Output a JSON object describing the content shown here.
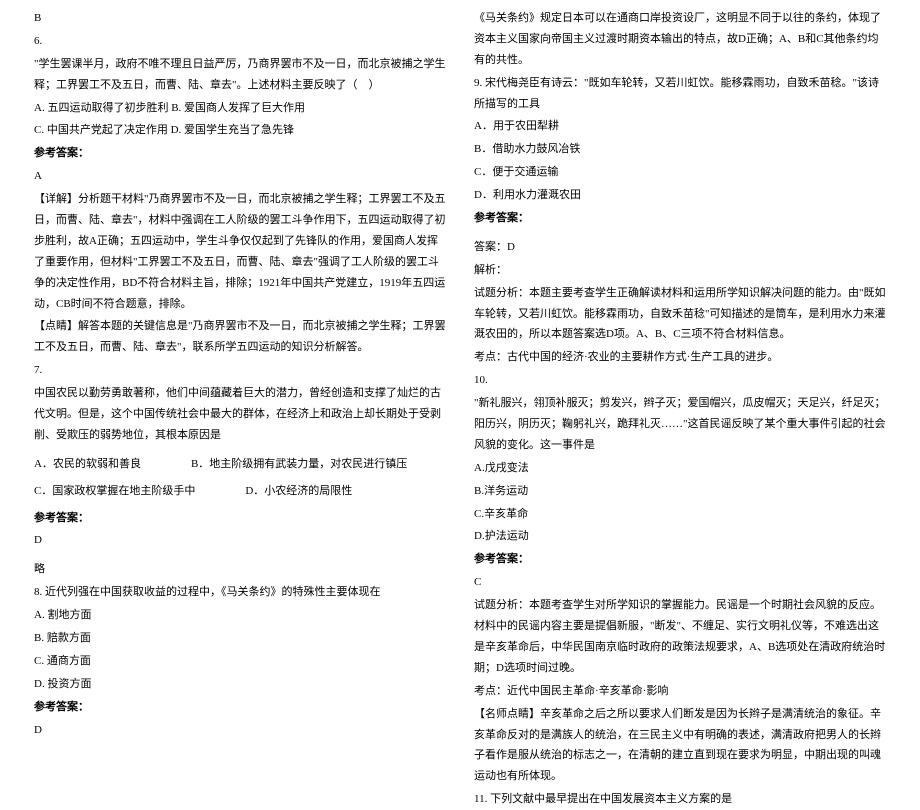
{
  "left": {
    "ansB": "B",
    "q6num": "6.",
    "q6text": "\"学生罢课半月，政府不唯不理且日益严厉，乃商界罢市不及一日，而北京被捕之学生释；工界罢工不及五日，而曹、陆、章去\"。上述材料主要反映了（　）",
    "q6A": "A. 五四运动取得了初步胜利 B. 爱国商人发挥了巨大作用",
    "q6C": "C. 中国共产党起了决定作用 D. 爱国学生充当了急先锋",
    "ref": "参考答案：",
    "q6ans": "A",
    "q6exp1": "【详解】分析题干材料\"乃商界罢市不及一日，而北京被捕之学生释；工界罢工不及五日，而曹、陆、章去\"，材料中强调在工人阶级的罢工斗争作用下，五四运动取得了初步胜利，故A正确；五四运动中，学生斗争仅仅起到了先锋队的作用，爱国商人发挥了重要作用，但材料\"工界罢工不及五日，而曹、陆、章去\"强调了工人阶级的罢工斗争的决定性作用，BD不符合材料主旨，排除；1921年中国共产党建立，1919年五四运动，CB时间不符合题意，排除。",
    "q6exp2": "【点睛】解答本题的关键信息是\"乃商界罢市不及一日，而北京被捕之学生释；工界罢工不及五日，而曹、陆、章去\"，联系所学五四运动的知识分析解答。",
    "q7num": "7.",
    "q7text": "中国农民以勤劳勇敢著称，他们中间蕴藏着巨大的潜力，曾经创造和支撑了灿烂的古代文明。但是，这个中国传统社会中最大的群体，在经济上和政治上却长期处于受剥削、受欺压的弱势地位，其根本原因是",
    "q7A": "A．农民的软弱和善良",
    "q7B": "B．地主阶级拥有武装力量，对农民进行镇压",
    "q7C": "C．国家政权掌握在地主阶级手中",
    "q7D": "D．小农经济的局限性",
    "q7ans": "D",
    "q7note": "略",
    "q8num": "8. 近代列强在中国获取收益的过程中，《马关条约》的特殊性主要体现在",
    "q8A": "A. 割地方面",
    "q8B": "B. 赔款方面",
    "q8C": "C. 通商方面",
    "q8D": "D. 投资方面",
    "q8ans": "D"
  },
  "right": {
    "q8exp": "《马关条约》规定日本可以在通商口岸投资设厂，这明显不同于以往的条约，体现了资本主义国家向帝国主义过渡时期资本输出的特点，故D正确；A、B和C其他条约均有的共性。",
    "q9num": "9. 宋代梅尧臣有诗云：\"既如车轮转，又若川虹饮。能移霖雨功，自致禾苗稔。\"该诗所描写的工具",
    "q9A": "A．用于农田犁耕",
    "q9B": "B．借助水力鼓风冶铁",
    "q9C": "C．便于交通运输",
    "q9D": "D．利用水力灌溉农田",
    "ref": "参考答案：",
    "q9anstitle": "答案：D",
    "q9exptitle": "解析：",
    "q9exp": "试题分析：本题主要考查学生正确解读材料和运用所学知识解决问题的能力。由\"既如车轮转，又若川虹饮。能移霖雨功，自致禾苗稔\"可知描述的是筒车，是利用水力来灌溉农田的，所以本题答案选D项。A、B、C三项不符合材料信息。",
    "q9point": "考点：古代中国的经济·农业的主要耕作方式·生产工具的进步。",
    "q10num": "10.",
    "q10text": "\"新礼服兴，翎顶补服灭；剪发兴，辫子灭；爱国帽兴，瓜皮帽灭；天足兴，纤足灭；阳历兴，阴历灭；鞠躬礼兴，跪拜礼灭……\"这首民谣反映了某个重大事件引起的社会风貌的变化。这一事件是",
    "q10A": "A.戊戌变法",
    "q10B": "B.洋务运动",
    "q10C": "C.辛亥革命",
    "q10D": "D.护法运动",
    "q10ans": "C",
    "q10exp": "试题分析：本题考查学生对所学知识的掌握能力。民谣是一个时期社会风貌的反应。材料中的民谣内容主要是提倡新服，\"断发\"、不缠足、实行文明礼仪等，不难选出这是辛亥革命后，中华民国南京临时政府的政策法规要求，A、B选项处在清政府统治时期；D选项时间过晚。",
    "q10point": "考点：近代中国民主革命·辛亥革命·影响",
    "q10note": "【名师点睛】辛亥革命之后之所以要求人们断发是因为长辫子是满清统治的象征。辛亥革命反对的是满族人的统治，在三民主义中有明确的表述，满清政府把男人的长辫子看作是服从统治的标志之一，在清朝的建立直到现在要求为明显，中期出现的叫魂运动也有所体现。",
    "q11": "11. 下列文献中最早提出在中国发展资本主义方案的是"
  }
}
